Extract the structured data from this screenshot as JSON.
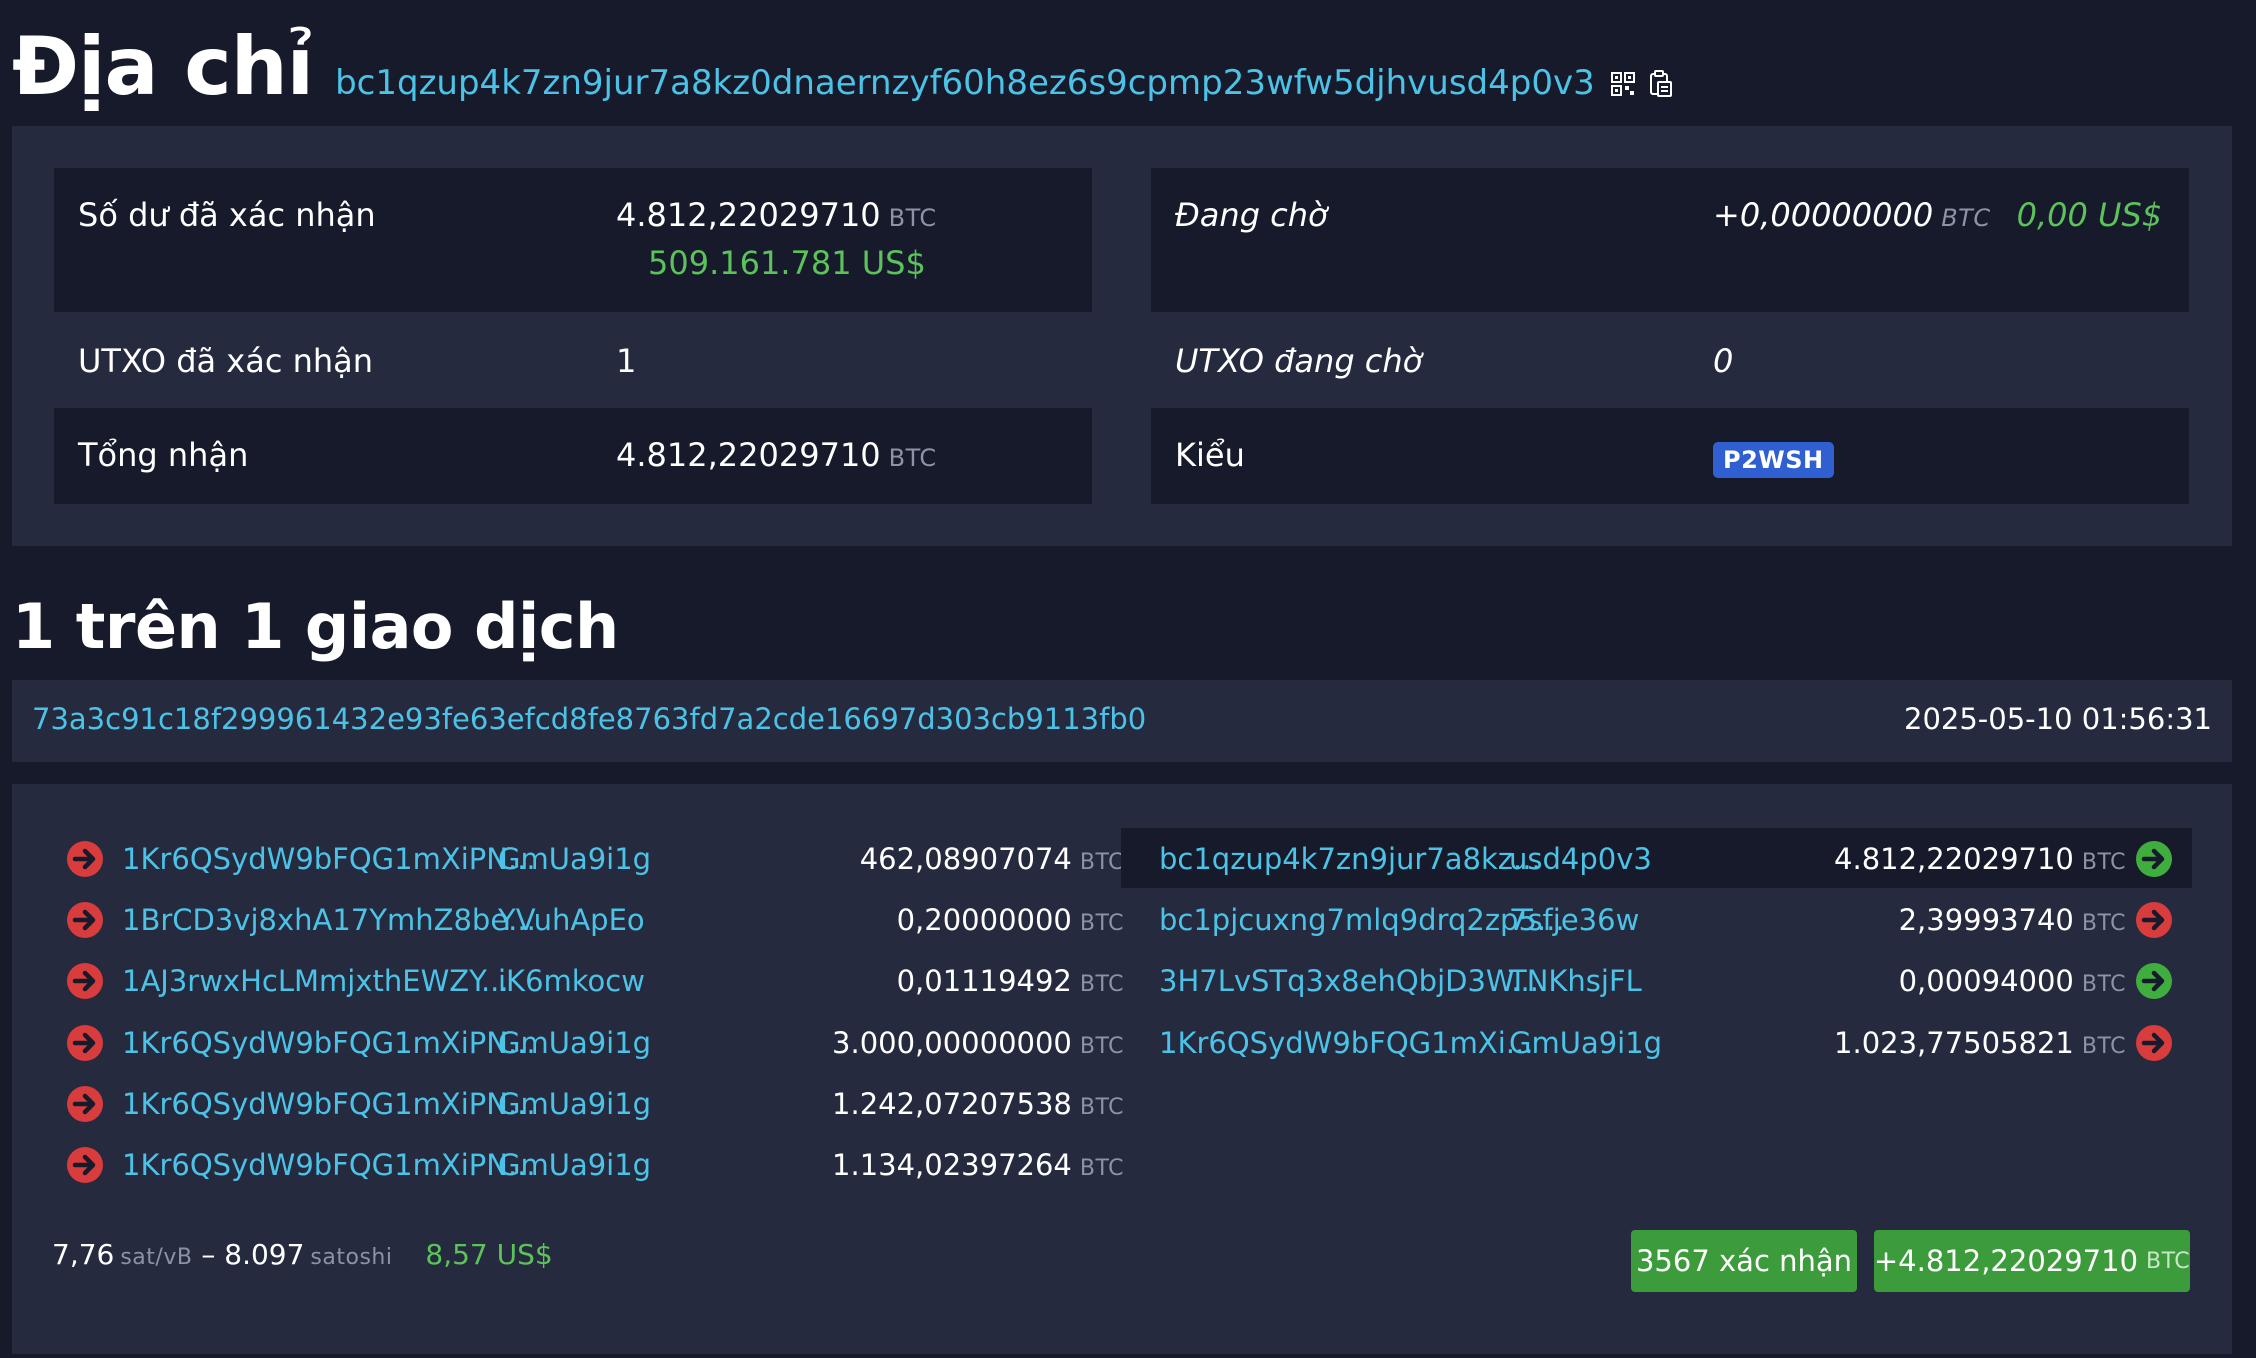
{
  "header": {
    "title": "Địa chỉ",
    "address": "bc1qzup4k7zn9jur7a8kz0dnaernzyf60h8ez6s9cpmp23wfw5djhvusd4p0v3",
    "icons": [
      "qr-code-icon",
      "copy-icon"
    ]
  },
  "summary": {
    "confirmed_balance_label": "Số dư đã xác nhận",
    "confirmed_balance_value": "4.812,22029710",
    "confirmed_balance_usd": "509.161.781 US$",
    "pending_label": "Đang chờ",
    "pending_value": "+0,00000000",
    "pending_usd": "0,00 US$",
    "confirmed_utxo_label": "UTXO đã xác nhận",
    "confirmed_utxo_value": "1",
    "pending_utxo_label": "UTXO đang chờ",
    "pending_utxo_value": "0",
    "total_received_label": "Tổng nhận",
    "total_received_value": "4.812,22029710",
    "type_label": "Kiểu",
    "type_value": "P2WSH",
    "unit": "BTC"
  },
  "transactions": {
    "count_title": "1 trên 1 giao dịch",
    "tx": {
      "hash": "73a3c91c18f299961432e93fe63efcd8fe8763fd7a2cde16697d303cb9113fb0",
      "time": "2025-05-10 01:56:31",
      "inputs": [
        {
          "addr_start": "1Kr6QSydW9bFQG1mXiPN...",
          "addr_end": "GmUa9i1g",
          "amount": "462,08907074",
          "unit": "BTC"
        },
        {
          "addr_start": "1BrCD3vj8xhA17YmhZ8be...",
          "addr_end": "YVuhApEo",
          "amount": "0,20000000",
          "unit": "BTC"
        },
        {
          "addr_start": "1AJ3rwxHcLMmjxthEWZY...",
          "addr_end": "iK6mkocw",
          "amount": "0,01119492",
          "unit": "BTC"
        },
        {
          "addr_start": "1Kr6QSydW9bFQG1mXiPN...",
          "addr_end": "GmUa9i1g",
          "amount": "3.000,00000000",
          "unit": "BTC"
        },
        {
          "addr_start": "1Kr6QSydW9bFQG1mXiPN...",
          "addr_end": "GmUa9i1g",
          "amount": "1.242,07207538",
          "unit": "BTC"
        },
        {
          "addr_start": "1Kr6QSydW9bFQG1mXiPN...",
          "addr_end": "GmUa9i1g",
          "amount": "1.134,02397264",
          "unit": "BTC"
        }
      ],
      "outputs": [
        {
          "addr_start": "bc1qzup4k7zn9jur7a8kz...",
          "addr_end": "usd4p0v3",
          "amount": "4.812,22029710",
          "unit": "BTC",
          "status": "unspent"
        },
        {
          "addr_start": "bc1pjcuxng7mlq9drq2zp5...",
          "addr_end": "7sfje36w",
          "amount": "2,39993740",
          "unit": "BTC",
          "status": "spent"
        },
        {
          "addr_start": "3H7LvSTq3x8ehQbjD3W...",
          "addr_end": "TNKhsjFL",
          "amount": "0,00094000",
          "unit": "BTC",
          "status": "unspent"
        },
        {
          "addr_start": "1Kr6QSydW9bFQG1mXi...",
          "addr_end": "GmUa9i1g",
          "amount": "1.023,77505821",
          "unit": "BTC",
          "status": "spent"
        }
      ],
      "fee_rate": "7,76",
      "fee_rate_unit": "sat/vB",
      "dash": "–",
      "fee": "8.097",
      "fee_unit": "satoshi",
      "fee_usd": "8,57 US$",
      "confirmations": "3567 xác nhận",
      "net_amount": "+4.812,22029710",
      "net_unit": "BTC"
    }
  },
  "colors": {
    "background": "#161a2b",
    "panel": "#252a3f",
    "link": "#4cc3e6",
    "usd": "#5cc25a",
    "spent_red": "#d83c3c",
    "unspent_green": "#3fae3f",
    "badge_blue": "#2f5fd0"
  }
}
